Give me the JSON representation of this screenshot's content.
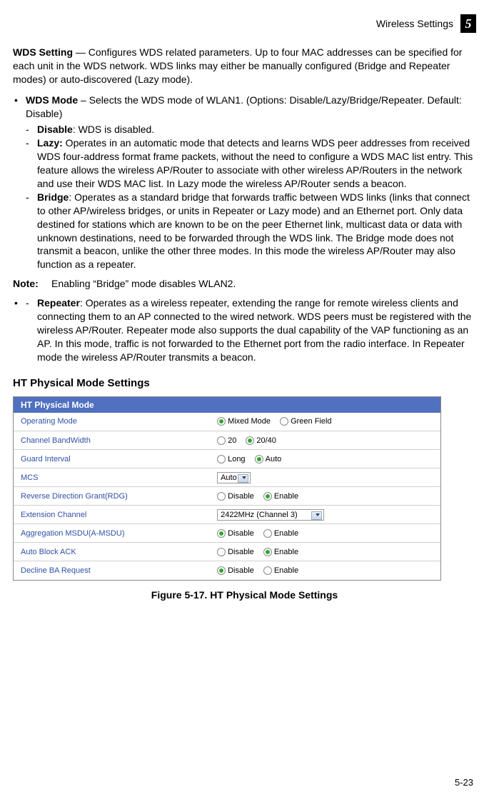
{
  "header": {
    "title": "Wireless Settings",
    "chapter": "5"
  },
  "wds_setting": {
    "label": "WDS Setting",
    "desc": " — Configures WDS related parameters. Up to four MAC addresses can be specified for each unit in the WDS network. WDS links may either be manually configured (Bridge and Repeater modes) or auto-discovered (Lazy mode)."
  },
  "wds_mode": {
    "label": "WDS Mode",
    "desc": " – Selects the WDS mode of WLAN1. (Options: Disable/Lazy/Bridge/Repeater. Default: Disable)"
  },
  "options": {
    "disable": {
      "label": "Disable",
      "desc": ": WDS is disabled."
    },
    "lazy": {
      "label": "Lazy:",
      "desc": " Operates in an automatic mode that detects and learns WDS peer addresses from received WDS four-address format frame packets, without the need to configure a WDS MAC list entry. This feature allows the wireless AP/Router to associate with other wireless AP/Routers in the network and use their WDS MAC list. In Lazy mode the wireless AP/Router sends a beacon."
    },
    "bridge": {
      "label": "Bridge",
      "desc": ": Operates as a standard bridge that forwards traffic between WDS links (links that connect to other AP/wireless bridges, or units in Repeater or Lazy mode) and an Ethernet port. Only data destined for stations which are known to be on the peer Ethernet link, multicast data or data with unknown destinations, need to be forwarded through the WDS link. The Bridge mode does not transmit a beacon, unlike the other three modes. In this mode the wireless AP/Router may also function as a repeater."
    },
    "repeater": {
      "label": "Repeater",
      "desc": ": Operates as a wireless repeater, extending the range for remote wireless clients and connecting them to an AP connected to the wired network. WDS peers must be registered with the wireless AP/Router. Repeater mode also supports the dual capability of the VAP functioning as an AP. In this mode, traffic is not forwarded to the Ethernet port from the radio interface. In Repeater mode the wireless AP/Router transmits a beacon."
    }
  },
  "note": {
    "label": "Note:",
    "text": "Enabling “Bridge” mode disables WLAN2."
  },
  "section_heading": "HT Physical Mode Settings",
  "panel_title": "HT Physical Mode",
  "rows": {
    "operating_mode": {
      "label": "Operating Mode",
      "opt1": "Mixed Mode",
      "opt2": "Green Field"
    },
    "channel_bandwidth": {
      "label": "Channel BandWidth",
      "opt1": "20",
      "opt2": "20/40"
    },
    "guard_interval": {
      "label": "Guard Interval",
      "opt1": "Long",
      "opt2": "Auto"
    },
    "mcs": {
      "label": "MCS",
      "value": "Auto"
    },
    "rdg": {
      "label": "Reverse Direction Grant(RDG)",
      "opt1": "Disable",
      "opt2": "Enable"
    },
    "extension_channel": {
      "label": "Extension Channel",
      "value": "2422MHz (Channel 3)"
    },
    "amsdu": {
      "label": "Aggregation MSDU(A-MSDU)",
      "opt1": "Disable",
      "opt2": "Enable"
    },
    "auto_block_ack": {
      "label": "Auto Block ACK",
      "opt1": "Disable",
      "opt2": "Enable"
    },
    "decline_ba": {
      "label": "Decline BA Request",
      "opt1": "Disable",
      "opt2": "Enable"
    }
  },
  "figure_caption": "Figure 5-17.   HT Physical Mode Settings",
  "page_number": "5-23"
}
